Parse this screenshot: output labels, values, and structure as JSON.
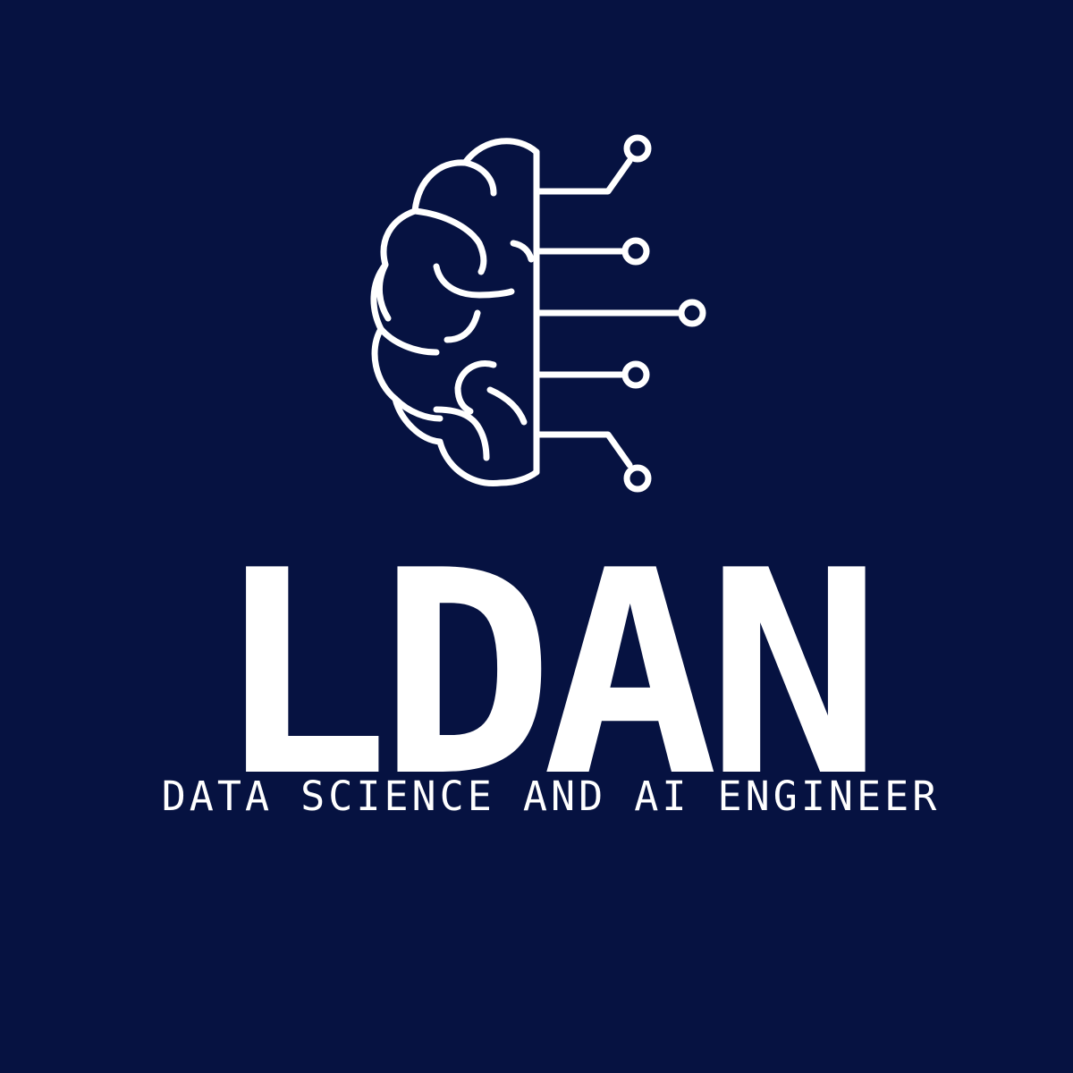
{
  "colors": {
    "background": "#061241",
    "foreground": "#ffffff"
  },
  "logo": {
    "icon": "brain-circuit-icon",
    "name": "LDAN",
    "tagline": "DATA SCIENCE AND AI ENGINEER"
  }
}
